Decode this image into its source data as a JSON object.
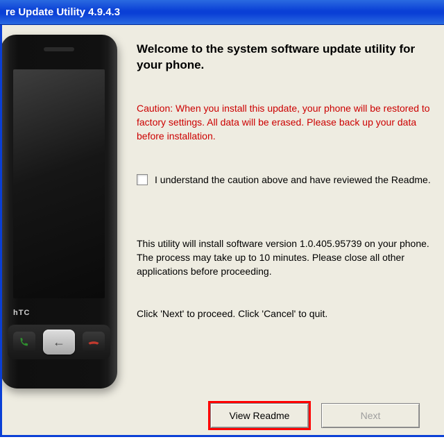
{
  "titlebar": {
    "title": "re Update Utility 4.9.4.3"
  },
  "phone": {
    "brand": "hTC"
  },
  "main": {
    "heading": "Welcome to the system software update utility for your phone.",
    "caution": "Caution: When you install this update, your phone will be restored to factory settings. All data will be erased. Please back up your data before installation.",
    "checkbox": {
      "checked": false,
      "label": "I understand the caution above and have reviewed the Readme."
    },
    "info": "This utility will install software version 1.0.405.95739 on your phone. The process may take up to 10 minutes. Please close all other applications before proceeding.",
    "nav_hint": "Click 'Next' to proceed. Click 'Cancel' to quit."
  },
  "buttons": {
    "view_readme": "View Readme",
    "next": "Next"
  }
}
